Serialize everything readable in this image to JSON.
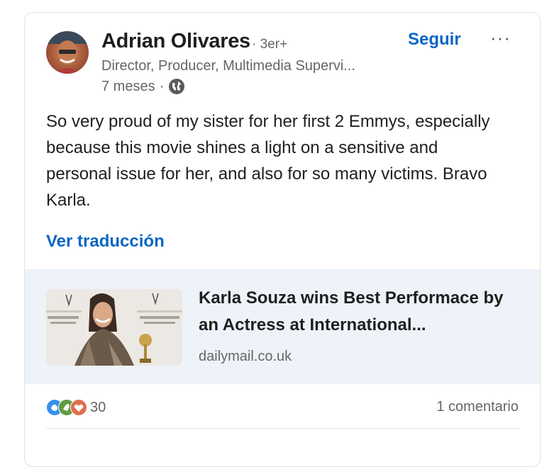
{
  "post": {
    "author": {
      "name": "Adrian Olivares",
      "degree": "· 3er+",
      "headline": "Director, Producer, Multimedia Supervi...",
      "time": "7 meses",
      "separator": "·",
      "visibility_icon": "globe-icon"
    },
    "follow_label": "Seguir",
    "more_label": "···",
    "text": "So very proud of my sister for her first 2 Emmys, especially because this movie shines a light on a sensitive and personal issue for her, and also for so many victims. Bravo Karla.",
    "translate_label": "Ver traducción",
    "link": {
      "title": "Karla Souza wins Best Performace by an Actress at International...",
      "source": "dailymail.co.uk"
    },
    "reactions": {
      "icons": [
        "clap-icon",
        "support-icon",
        "love-icon"
      ],
      "count": "30"
    },
    "comments_label": "1 comentario"
  },
  "colors": {
    "accent": "#0a66c2",
    "link_card_bg": "#edf3f8",
    "muted_text": "#666666"
  }
}
